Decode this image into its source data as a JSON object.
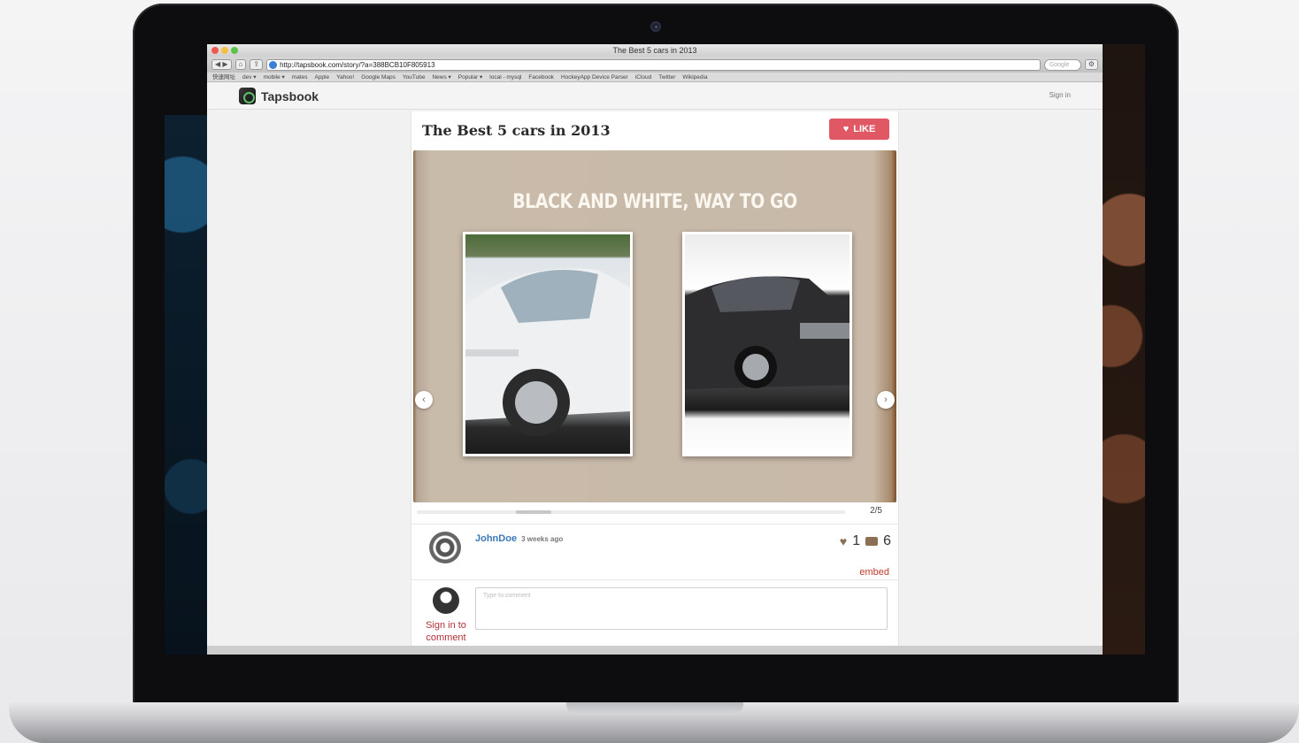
{
  "browser": {
    "window_title": "The Best 5 cars in 2013",
    "url": "http://tapsbook.com/story/?a=388BCB10F805913",
    "back_label": "◀ ▶",
    "search_placeholder": "Google",
    "bookmarks": [
      "快速网址",
      "dev ▾",
      "mobile ▾",
      "mates",
      "Apple",
      "Yahoo!",
      "Google Maps",
      "YouTube",
      "News ▾",
      "Popular ▾",
      "local - mysql",
      "Facebook",
      "HockeyApp Device Parser",
      "iCloud",
      "Twitter",
      "Wikipedia"
    ]
  },
  "site": {
    "logo_text": "Tapsbook",
    "signin_label": "Sign in"
  },
  "story": {
    "title": "The Best 5 cars in 2013",
    "like_label": "LIKE",
    "page_heading": "BLACK AND WHITE, WAY TO GO",
    "prev_arrow": "‹",
    "next_arrow": "›",
    "page_counter": "2/5",
    "current_page": 2,
    "total_pages": 5
  },
  "author": {
    "name": "JohnDoe",
    "time": "3 weeks ago",
    "likes": "1",
    "comments": "6",
    "embed_label": "embed"
  },
  "comment": {
    "placeholder": "Type to comment",
    "signin_label": "Sign in to comment"
  },
  "colors": {
    "like_button": "#e05863",
    "author_link": "#3a78b5",
    "accent_red": "#c0392b",
    "book_background": "#c8b9a8"
  },
  "icons": {
    "heart": "heart-icon",
    "comment": "comment-bubble-icon",
    "globe": "globe-icon"
  }
}
